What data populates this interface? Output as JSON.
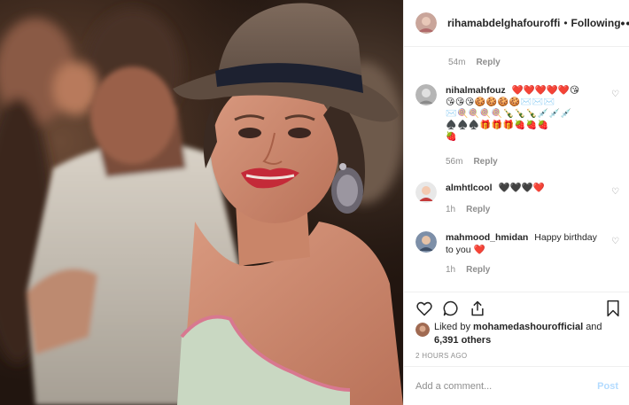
{
  "header": {
    "username": "rihamabdelghafouroffi",
    "separator": "•",
    "follow_status": "Following",
    "more_glyph": "•••"
  },
  "comments": [
    {
      "username": "",
      "text": "",
      "time": "54m",
      "reply_label": "Reply"
    },
    {
      "username": "nihalmahfouz",
      "text": "❤️❤️❤️❤️❤️😘",
      "emoji_lines": [
        "😘😘😘🍪🍪🍪🍪✉️✉️✉️",
        "✉️🍭🍭🍭🍭🍾🍾🍾💉💉💉",
        "♠️♠️♠️🎁🎁🎁🍓🍓🍓",
        "🍓"
      ],
      "time": "56m",
      "reply_label": "Reply"
    },
    {
      "username": "almhtlcool",
      "text": "🖤🖤🖤❤️",
      "time": "1h",
      "reply_label": "Reply"
    },
    {
      "username": "mahmood_hmidan",
      "text": "Happy birthday to you ❤️",
      "time": "1h",
      "reply_label": "Reply"
    }
  ],
  "actions": {
    "heart_icon": "heart-outline",
    "comment_icon": "speech-bubble",
    "share_icon": "share-arrow",
    "save_icon": "bookmark"
  },
  "likes": {
    "prefix": "Liked by",
    "user": "mohamedashourofficial",
    "connector": "and",
    "count": "6,391 others"
  },
  "timestamp": "2 HOURS AGO",
  "add_comment": {
    "placeholder": "Add a comment...",
    "post_label": "Post"
  },
  "colors": {
    "text": "#262626",
    "secondary": "#8e8e8e",
    "border": "#efefef",
    "post_disabled": "#b3dbff",
    "like_red": "#ed4956"
  }
}
